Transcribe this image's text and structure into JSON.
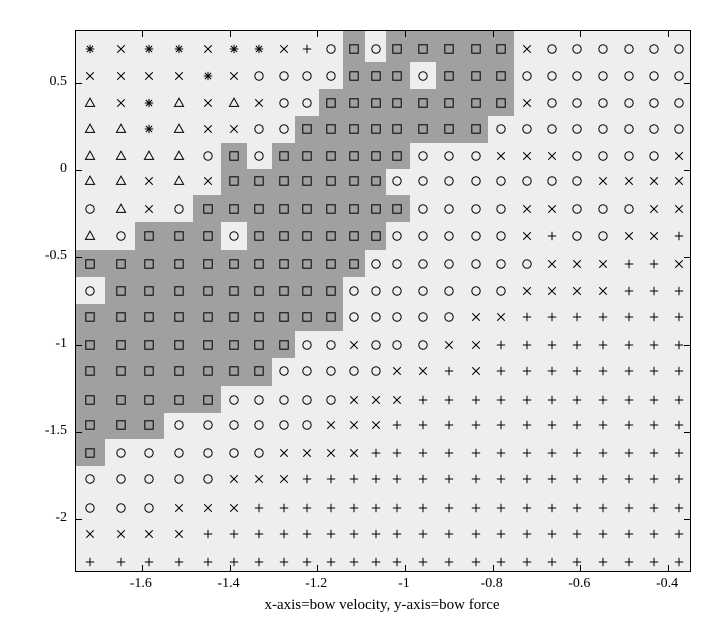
{
  "chart_data": {
    "type": "scatter",
    "title": "",
    "xlabel": "x-axis=bow velocity, y-axis=bow force",
    "ylabel": "",
    "xlim": [
      -1.75,
      -0.35
    ],
    "ylim": [
      -2.3,
      0.8
    ],
    "xticks": [
      -1.6,
      -1.4,
      -1.2,
      -1.0,
      -0.8,
      -0.6,
      -0.4
    ],
    "xtick_labels": [
      "-1.6",
      "-1.4",
      "-1.2",
      "-1",
      "-0.8",
      "-0.6",
      "-0.4"
    ],
    "yticks": [
      -2.0,
      -1.5,
      -1.0,
      -0.5,
      0,
      0.5
    ],
    "ytick_labels": [
      "-2",
      "-1.5",
      "-1",
      "-0.5",
      "0",
      "0.5"
    ],
    "x_grid": [
      -1.7181,
      -1.6476,
      -1.5825,
      -1.5154,
      -1.4499,
      -1.3887,
      -1.3317,
      -1.2767,
      -1.2229,
      -1.1685,
      -1.1156,
      -1.0663,
      -1.0181,
      -0.9593,
      -0.8984,
      -0.8382,
      -0.7808,
      -0.7228,
      -0.665,
      -0.6075,
      -0.5476,
      -0.4884,
      -0.4327,
      -0.3754
    ],
    "y_grid": [
      0.6961,
      0.5444,
      0.3867,
      0.2373,
      0.0815,
      -0.0625,
      -0.2222,
      -0.3758,
      -0.536,
      -0.6917,
      -0.8446,
      -1.004,
      -1.1539,
      -1.3186,
      -1.4635,
      -1.6205,
      -1.7726,
      -1.9407,
      -2.0882,
      -2.2491
    ],
    "marker_types": [
      "star",
      "x",
      "triangle",
      "circle",
      "square",
      "plus"
    ],
    "markers": [
      [
        "star",
        "x",
        "star",
        "star",
        "x",
        "star",
        "star",
        "x",
        "plus",
        "circle",
        "square",
        "circle",
        "square",
        "square",
        "square",
        "square",
        "square",
        "x",
        "circle",
        "circle",
        "circle",
        "circle",
        "circle",
        "circle"
      ],
      [
        "x",
        "x",
        "x",
        "x",
        "star",
        "x",
        "circle",
        "circle",
        "circle",
        "circle",
        "square",
        "square",
        "square",
        "circle",
        "square",
        "square",
        "square",
        "circle",
        "circle",
        "circle",
        "circle",
        "circle",
        "circle",
        "circle"
      ],
      [
        "triangle",
        "x",
        "star",
        "triangle",
        "x",
        "triangle",
        "x",
        "circle",
        "circle",
        "square",
        "square",
        "square",
        "square",
        "square",
        "square",
        "square",
        "square",
        "x",
        "circle",
        "circle",
        "circle",
        "circle",
        "circle",
        "circle"
      ],
      [
        "triangle",
        "triangle",
        "star",
        "triangle",
        "x",
        "x",
        "circle",
        "circle",
        "square",
        "square",
        "square",
        "square",
        "square",
        "square",
        "square",
        "square",
        "circle",
        "circle",
        "circle",
        "circle",
        "circle",
        "circle",
        "circle",
        "circle"
      ],
      [
        "triangle",
        "triangle",
        "triangle",
        "triangle",
        "circle",
        "square",
        "circle",
        "square",
        "square",
        "square",
        "square",
        "square",
        "square",
        "circle",
        "circle",
        "circle",
        "x",
        "x",
        "x",
        "circle",
        "circle",
        "circle",
        "circle",
        "x"
      ],
      [
        "triangle",
        "triangle",
        "x",
        "triangle",
        "x",
        "square",
        "square",
        "square",
        "square",
        "square",
        "square",
        "square",
        "circle",
        "circle",
        "circle",
        "circle",
        "circle",
        "circle",
        "circle",
        "circle",
        "x",
        "x",
        "x",
        "x"
      ],
      [
        "circle",
        "triangle",
        "x",
        "circle",
        "square",
        "square",
        "square",
        "square",
        "square",
        "square",
        "square",
        "square",
        "square",
        "circle",
        "circle",
        "circle",
        "circle",
        "x",
        "x",
        "circle",
        "circle",
        "circle",
        "x",
        "x"
      ],
      [
        "triangle",
        "circle",
        "square",
        "square",
        "square",
        "circle",
        "square",
        "square",
        "square",
        "square",
        "square",
        "square",
        "circle",
        "circle",
        "circle",
        "circle",
        "circle",
        "x",
        "plus",
        "circle",
        "circle",
        "x",
        "x",
        "plus"
      ],
      [
        "square",
        "square",
        "square",
        "square",
        "square",
        "square",
        "square",
        "square",
        "square",
        "square",
        "square",
        "circle",
        "circle",
        "circle",
        "circle",
        "circle",
        "circle",
        "circle",
        "x",
        "x",
        "x",
        "plus",
        "plus",
        "x"
      ],
      [
        "circle",
        "square",
        "square",
        "square",
        "square",
        "square",
        "square",
        "square",
        "square",
        "square",
        "circle",
        "circle",
        "circle",
        "circle",
        "circle",
        "circle",
        "circle",
        "x",
        "x",
        "x",
        "x",
        "plus",
        "plus",
        "plus"
      ],
      [
        "square",
        "square",
        "square",
        "square",
        "square",
        "square",
        "square",
        "square",
        "square",
        "square",
        "circle",
        "circle",
        "circle",
        "circle",
        "circle",
        "x",
        "x",
        "plus",
        "plus",
        "plus",
        "plus",
        "plus",
        "plus",
        "plus"
      ],
      [
        "square",
        "square",
        "square",
        "square",
        "square",
        "square",
        "square",
        "square",
        "circle",
        "circle",
        "x",
        "circle",
        "circle",
        "circle",
        "x",
        "x",
        "plus",
        "plus",
        "plus",
        "plus",
        "plus",
        "plus",
        "plus",
        "plus"
      ],
      [
        "square",
        "square",
        "square",
        "square",
        "square",
        "square",
        "square",
        "circle",
        "circle",
        "circle",
        "circle",
        "circle",
        "x",
        "x",
        "plus",
        "x",
        "plus",
        "plus",
        "plus",
        "plus",
        "plus",
        "plus",
        "plus",
        "plus"
      ],
      [
        "square",
        "square",
        "square",
        "square",
        "square",
        "circle",
        "circle",
        "circle",
        "circle",
        "circle",
        "x",
        "x",
        "x",
        "plus",
        "plus",
        "plus",
        "plus",
        "plus",
        "plus",
        "plus",
        "plus",
        "plus",
        "plus",
        "plus"
      ],
      [
        "square",
        "square",
        "square",
        "circle",
        "circle",
        "circle",
        "circle",
        "circle",
        "circle",
        "x",
        "x",
        "x",
        "plus",
        "plus",
        "plus",
        "plus",
        "plus",
        "plus",
        "plus",
        "plus",
        "plus",
        "plus",
        "plus",
        "plus"
      ],
      [
        "square",
        "circle",
        "circle",
        "circle",
        "circle",
        "circle",
        "circle",
        "x",
        "x",
        "x",
        "x",
        "plus",
        "plus",
        "plus",
        "plus",
        "plus",
        "plus",
        "plus",
        "plus",
        "plus",
        "plus",
        "plus",
        "plus",
        "plus"
      ],
      [
        "circle",
        "circle",
        "circle",
        "circle",
        "circle",
        "x",
        "x",
        "x",
        "plus",
        "plus",
        "plus",
        "plus",
        "plus",
        "plus",
        "plus",
        "plus",
        "plus",
        "plus",
        "plus",
        "plus",
        "plus",
        "plus",
        "plus",
        "plus"
      ],
      [
        "circle",
        "circle",
        "circle",
        "x",
        "x",
        "x",
        "plus",
        "plus",
        "plus",
        "plus",
        "plus",
        "plus",
        "plus",
        "plus",
        "plus",
        "plus",
        "plus",
        "plus",
        "plus",
        "plus",
        "plus",
        "plus",
        "plus",
        "plus"
      ],
      [
        "x",
        "x",
        "x",
        "x",
        "plus",
        "plus",
        "plus",
        "plus",
        "plus",
        "plus",
        "plus",
        "plus",
        "plus",
        "plus",
        "plus",
        "plus",
        "plus",
        "plus",
        "plus",
        "plus",
        "plus",
        "plus",
        "plus",
        "plus"
      ],
      [
        "plus",
        "plus",
        "plus",
        "plus",
        "plus",
        "plus",
        "plus",
        "plus",
        "plus",
        "plus",
        "plus",
        "plus",
        "plus",
        "plus",
        "plus",
        "plus",
        "plus",
        "plus",
        "plus",
        "plus",
        "plus",
        "plus",
        "plus",
        "plus"
      ]
    ]
  }
}
